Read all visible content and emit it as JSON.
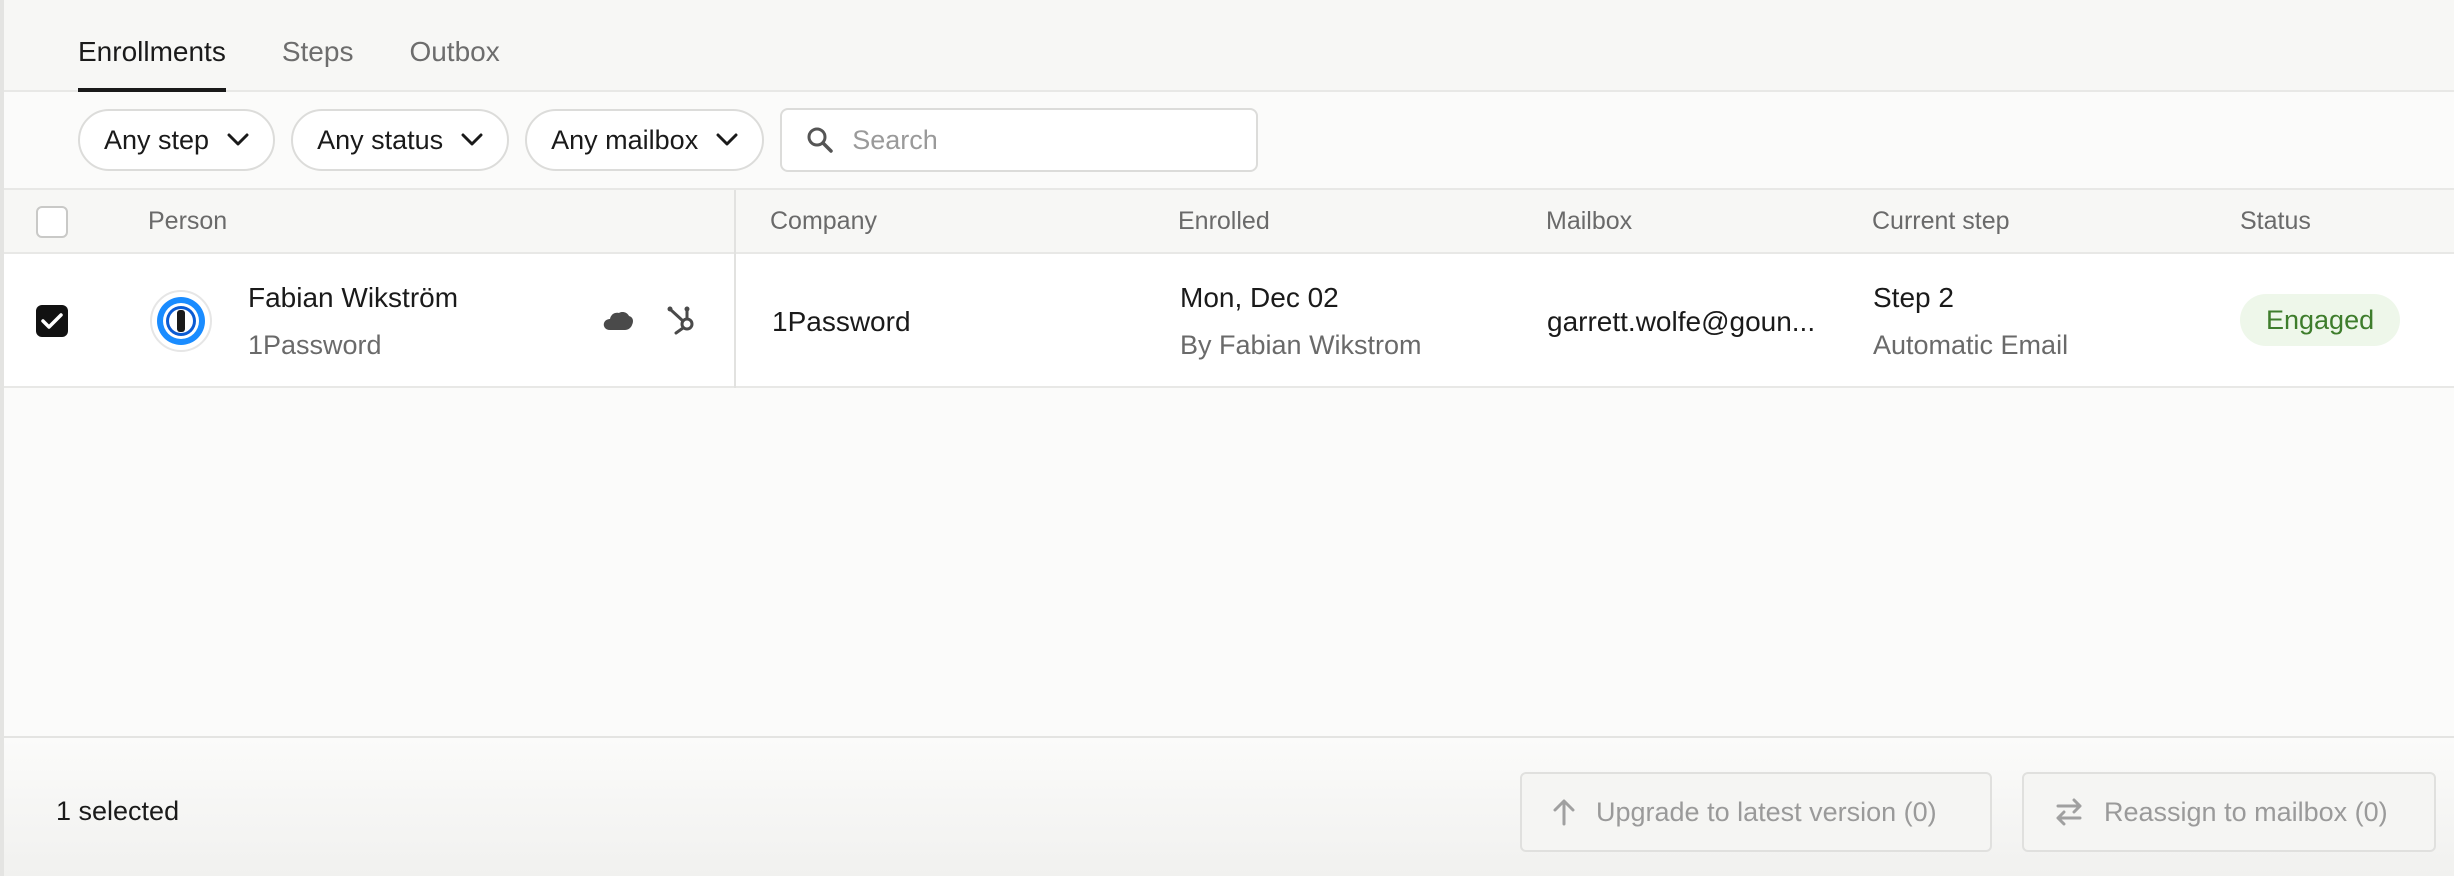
{
  "tabs": [
    {
      "label": "Enrollments",
      "active": true
    },
    {
      "label": "Steps",
      "active": false
    },
    {
      "label": "Outbox",
      "active": false
    }
  ],
  "filters": {
    "step": "Any step",
    "status": "Any status",
    "mailbox": "Any mailbox",
    "search_placeholder": "Search"
  },
  "table": {
    "headers": {
      "person": "Person",
      "company": "Company",
      "enrolled": "Enrolled",
      "mailbox": "Mailbox",
      "current_step": "Current step",
      "status": "Status"
    },
    "rows": [
      {
        "checked": true,
        "person_name": "Fabian Wikström",
        "person_company": "1Password",
        "company": "1Password",
        "enrolled_date": "Mon, Dec 02",
        "enrolled_by": "By Fabian Wikstrom",
        "mailbox": "garrett.wolfe@goun...",
        "step": "Step 2",
        "step_type": "Automatic Email",
        "status": "Engaged"
      }
    ]
  },
  "footer": {
    "selected_label": "1 selected",
    "upgrade_label": "Upgrade to latest version (0)",
    "reassign_label": "Reassign to mailbox (0)"
  },
  "colors": {
    "accent": "#1a1a1a",
    "status_engaged_bg": "#eef7ea",
    "status_engaged_text": "#3e7d2c"
  },
  "icons": {
    "search": "search-icon",
    "chevron": "chevron-down-icon",
    "salesforce": "salesforce-cloud-icon",
    "hubspot": "hubspot-icon",
    "upgrade": "arrow-up-icon",
    "reassign": "swap-arrows-icon"
  }
}
